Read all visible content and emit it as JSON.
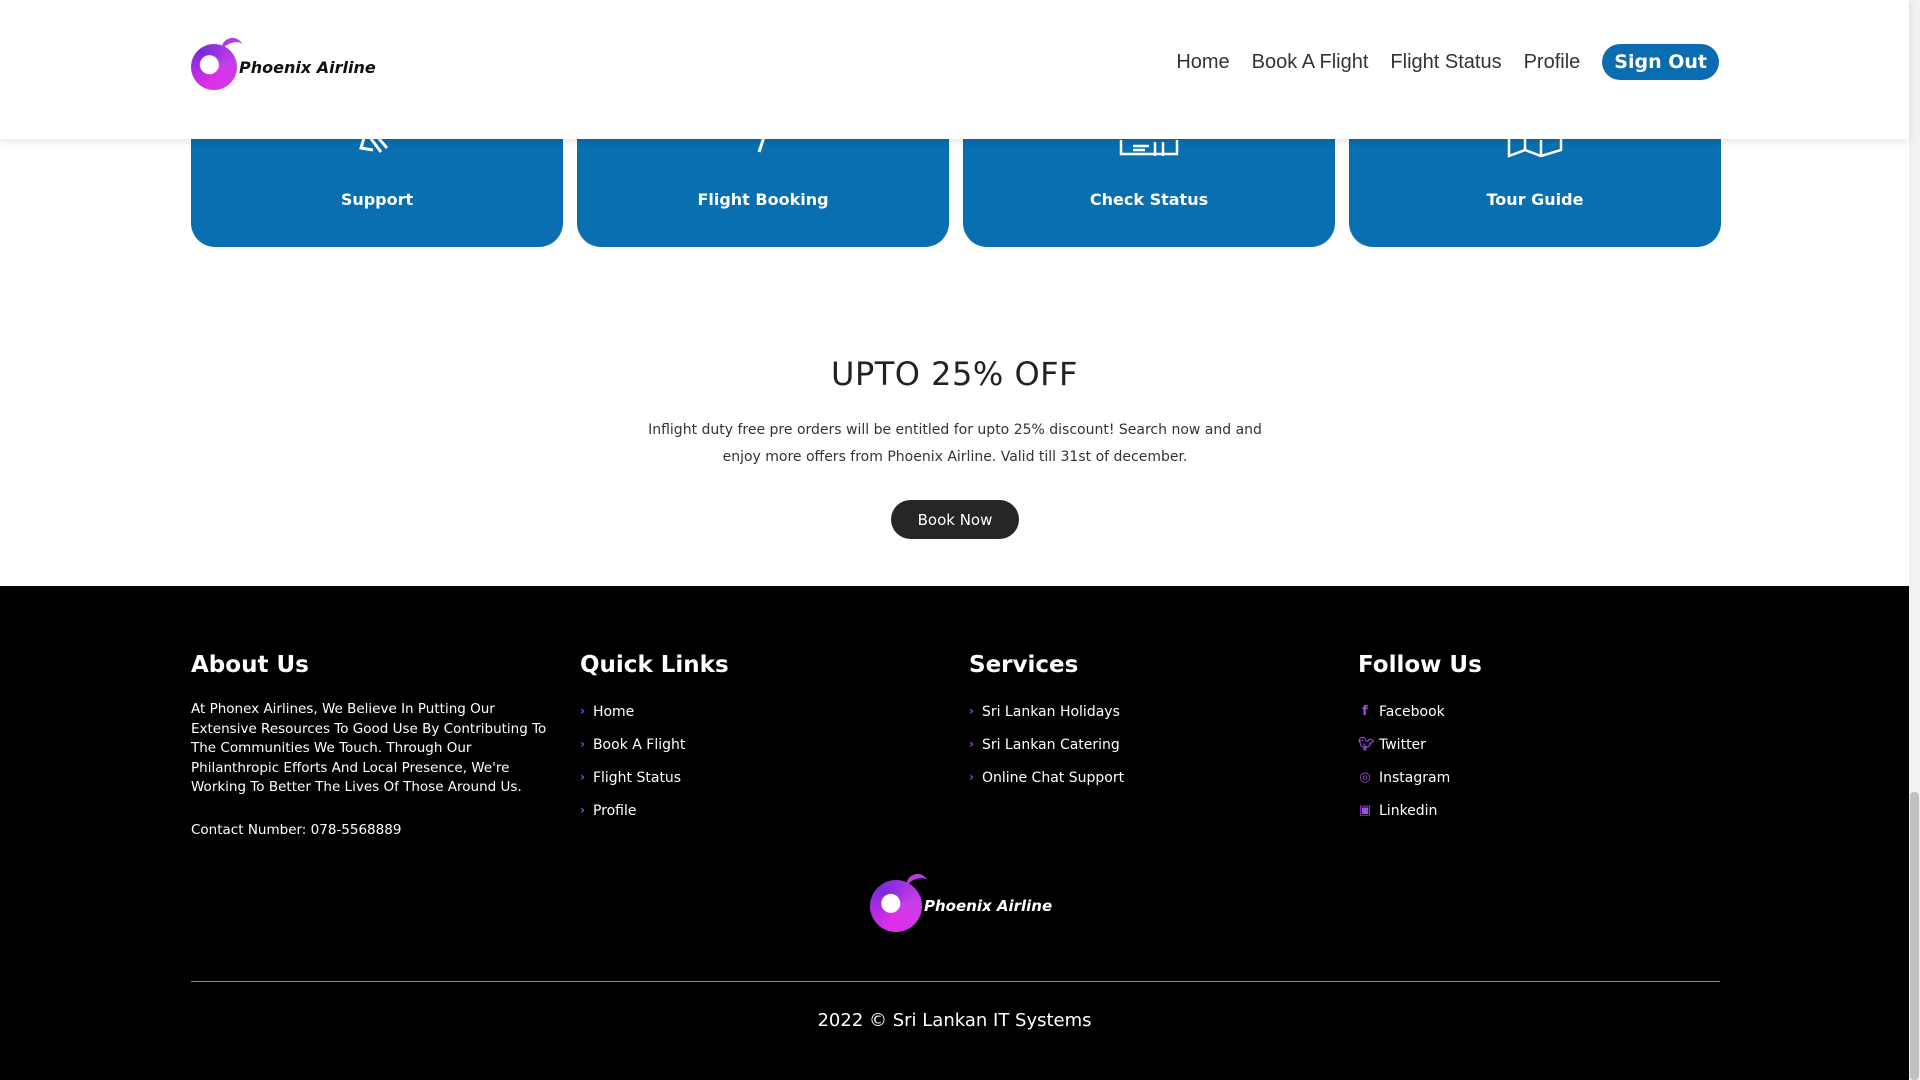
{
  "header": {
    "brand": "Phoenix Airline",
    "nav": [
      "Home",
      "Book A Flight",
      "Flight Status",
      "Profile"
    ],
    "sign_out": "Sign Out"
  },
  "cards": [
    {
      "label": "Support",
      "icon": "support-icon"
    },
    {
      "label": "Flight Booking",
      "icon": "flight-booking-icon"
    },
    {
      "label": "Check Status",
      "icon": "check-status-icon"
    },
    {
      "label": "Tour Guide",
      "icon": "map-icon"
    }
  ],
  "offer": {
    "title": "UPTO 25% OFF",
    "description": "Inflight duty free pre orders will be entitled for upto 25% discount! Search now and and enjoy more offers from Phoenix Airline. Valid till 31st of december.",
    "button": "Book Now"
  },
  "footer": {
    "about": {
      "heading": "About Us",
      "text": "At Phonex Airlines, We Believe In Putting Our Extensive Resources To Good Use By Contributing To The Communities We Touch. Through Our Philanthropic Efforts And Local Presence, We're Working To Better The Lives Of Those Around Us.",
      "contact": "Contact Number: 078-5568889"
    },
    "quick_links": {
      "heading": "Quick Links",
      "items": [
        "Home",
        "Book A Flight",
        "Flight Status",
        "Profile"
      ]
    },
    "services": {
      "heading": "Services",
      "items": [
        "Sri Lankan Holidays",
        "Sri Lankan Catering",
        "Online Chat Support"
      ]
    },
    "follow": {
      "heading": "Follow Us",
      "items": [
        {
          "label": "Facebook",
          "icon": "facebook-icon"
        },
        {
          "label": "Twitter",
          "icon": "twitter-icon"
        },
        {
          "label": "Instagram",
          "icon": "instagram-icon"
        },
        {
          "label": "Linkedin",
          "icon": "linkedin-icon"
        }
      ]
    },
    "brand": "Phoenix Airline",
    "copyright": "2022 © Sri Lankan IT Systems"
  },
  "colors": {
    "accent_blue": "#0a6fb0",
    "footer_bg": "#000000",
    "icon_purple": "#a24de8"
  }
}
